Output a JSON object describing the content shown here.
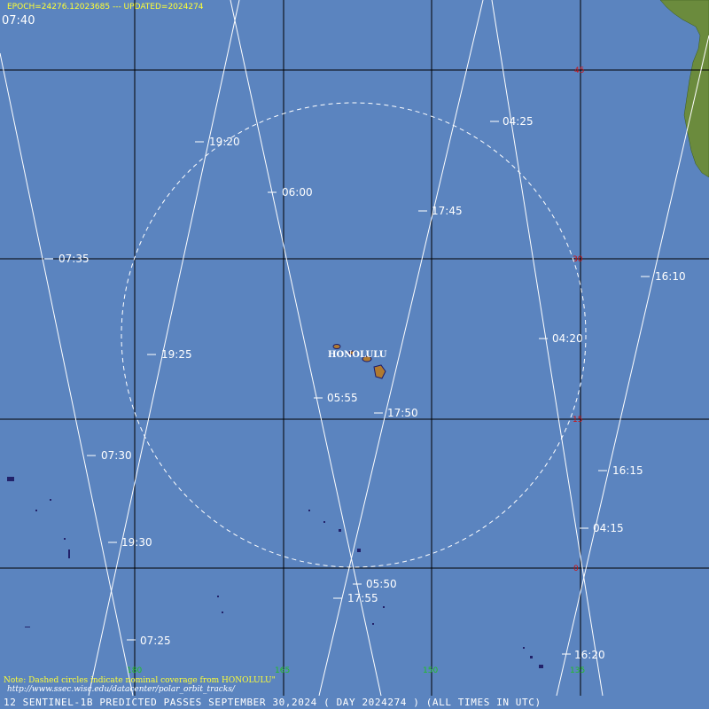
{
  "header": {
    "epoch": "EPOCH=24276.12023685 --- UPDATED=2024274",
    "corner_time": "07:40"
  },
  "map": {
    "station": "HONOLULU",
    "latitudes": [
      "45",
      "30",
      "15",
      "0"
    ],
    "longitudes": [
      "180",
      "165",
      "150",
      "135"
    ],
    "pass_times": [
      "19:20",
      "06:00",
      "04:25",
      "17:45",
      "07:35",
      "16:10",
      "04:20",
      "19:25",
      "05:55",
      "17:50",
      "07:30",
      "16:15",
      "04:15",
      "19:30",
      "05:50",
      "17:55",
      "07:25",
      "16:20"
    ]
  },
  "notes": {
    "coverage_note": "Note: Dashed circles indicate nominal coverage from HONOLULU\"",
    "url": "http://www.ssec.wisc.edu/datacenter/polar_orbit_tracks/"
  },
  "footer": {
    "caption": "12 SENTINEL-1B PREDICTED PASSES SEPTEMBER 30,2024 ( DAY 2024274 ) (ALL TIMES IN UTC)"
  },
  "colors": {
    "ocean": "#5b84bf",
    "track": "#ffffff",
    "latitude_label": "#d01010",
    "longitude_label": "#20c020",
    "note": "#ffff33"
  }
}
